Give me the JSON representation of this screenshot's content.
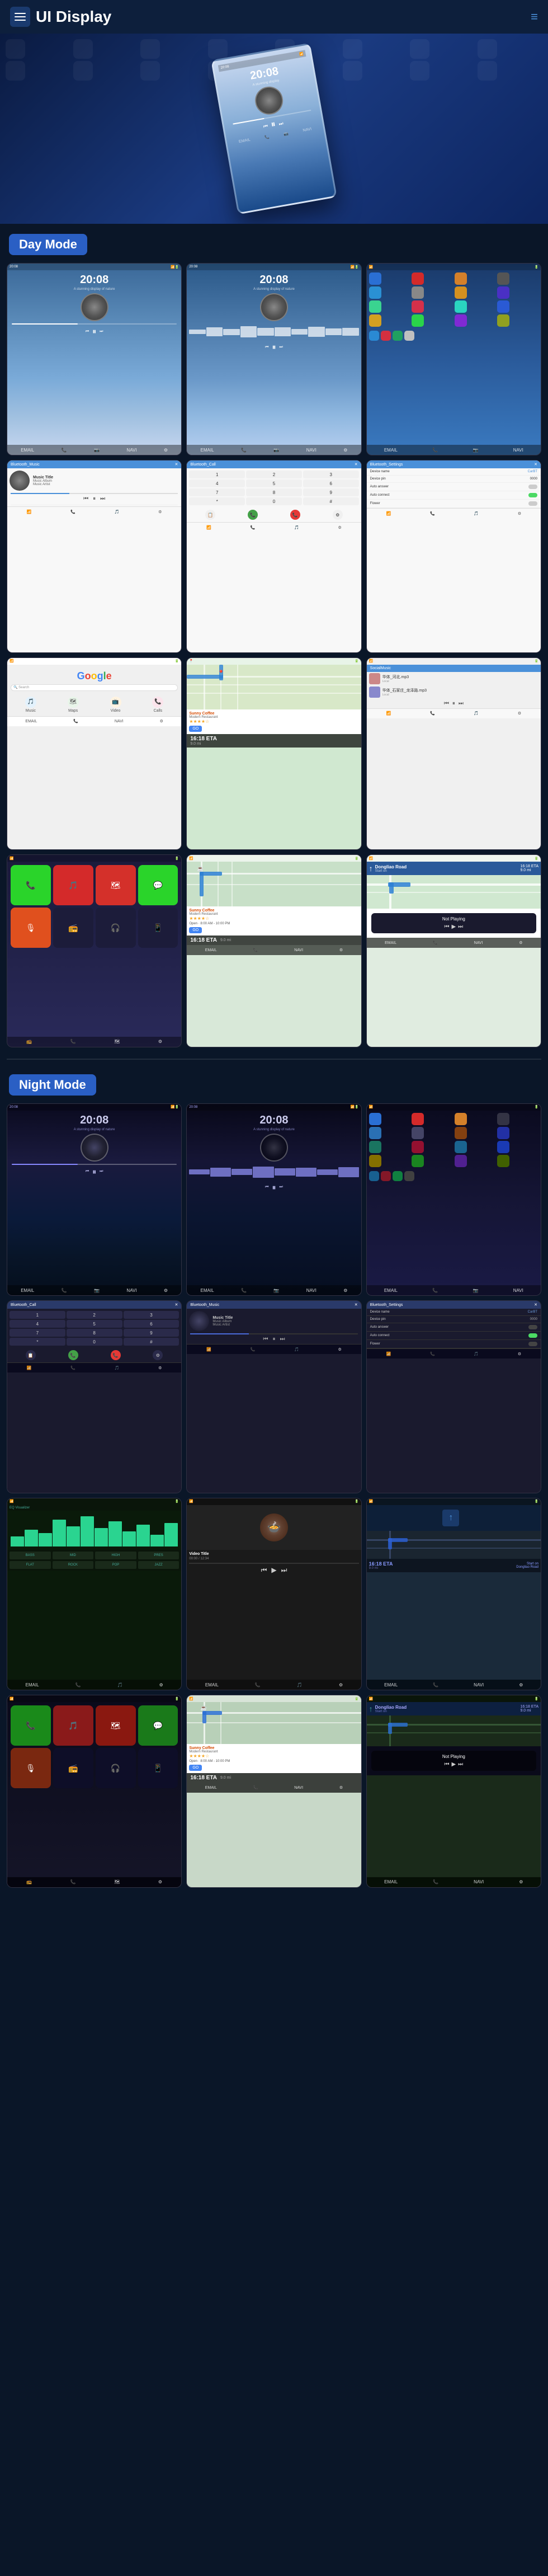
{
  "header": {
    "title": "UI Display",
    "menu_icon": "☰",
    "nav_icon": "≡"
  },
  "sections": {
    "day_mode": {
      "label": "Day Mode"
    },
    "night_mode": {
      "label": "Night Mode"
    }
  },
  "day_screens": [
    {
      "id": "day-music-1",
      "type": "music_player",
      "time": "20:08",
      "subtitle": "A stunning display of nature"
    },
    {
      "id": "day-music-2",
      "type": "music_player",
      "time": "20:08",
      "subtitle": "A stunning display of nature"
    },
    {
      "id": "day-apps",
      "type": "app_grid"
    },
    {
      "id": "day-bt-music",
      "type": "bluetooth_music",
      "title": "Bluetooth_Music",
      "track": "Music Title",
      "album": "Music Album",
      "artist": "Music Artist"
    },
    {
      "id": "day-bt-call",
      "type": "bluetooth_call",
      "title": "Bluetooth_Call"
    },
    {
      "id": "day-bt-settings",
      "type": "bluetooth_settings",
      "title": "Bluetooth_Settings",
      "device_name": "CarBT",
      "device_pin": "0000"
    },
    {
      "id": "day-google",
      "type": "google_search"
    },
    {
      "id": "day-navigation",
      "type": "navigation"
    },
    {
      "id": "day-social-music",
      "type": "social_music",
      "title": "SocialMusic"
    },
    {
      "id": "day-carplay",
      "type": "carplay"
    },
    {
      "id": "day-maps-coffee",
      "type": "maps_coffee",
      "place": "Sunny Coffee",
      "address": "Modern Restaurant",
      "rating": "★★★★☆"
    },
    {
      "id": "day-maps-eta",
      "type": "maps_eta",
      "eta_time": "16'10 ETA",
      "distance": "9.0 mi",
      "road": "Start on Dongliao Road"
    }
  ],
  "night_screens": [
    {
      "id": "night-music-1",
      "type": "music_player_night",
      "time": "20:08",
      "subtitle": "A stunning display of nature"
    },
    {
      "id": "night-music-2",
      "type": "music_player_night",
      "time": "20:08",
      "subtitle": "A stunning display of nature"
    },
    {
      "id": "night-apps",
      "type": "app_grid_night"
    },
    {
      "id": "night-bt-call",
      "type": "bluetooth_call_night",
      "title": "Bluetooth_Call"
    },
    {
      "id": "night-bt-music",
      "type": "bluetooth_music_night",
      "title": "Bluetooth_Music",
      "track": "Music Title",
      "album": "Music Album",
      "artist": "Music Artist"
    },
    {
      "id": "night-bt-settings",
      "type": "bluetooth_settings_night",
      "title": "Bluetooth_Settings",
      "device_name": "CarBT",
      "device_pin": "0000"
    },
    {
      "id": "night-equalizer",
      "type": "equalizer_night"
    },
    {
      "id": "night-video",
      "type": "video_night"
    },
    {
      "id": "night-navigation",
      "type": "navigation_night"
    },
    {
      "id": "night-carplay",
      "type": "carplay_night"
    },
    {
      "id": "night-maps-coffee",
      "type": "maps_coffee_night",
      "place": "Sunny Coffee",
      "address": "Modern Restaurant"
    },
    {
      "id": "night-maps-eta",
      "type": "maps_eta_night",
      "eta_time": "16'10 ETA",
      "distance": "9.0 mi",
      "road": "Start on Dongliao Road"
    }
  ],
  "labels": {
    "music_title": "Music Title",
    "music_album": "Music Album",
    "music_artist": "Music Artist",
    "bluetooth_music": "Bluetooth_Music",
    "bluetooth_call": "Bluetooth_Call",
    "bluetooth_settings": "Bluetooth_Settings",
    "social_music": "SocialMusic",
    "device_name_label": "Device name",
    "device_pin_label": "Device pin",
    "auto_answer_label": "Auto answer",
    "auto_connect_label": "Auto connect",
    "flower_label": "Flower",
    "car_bt": "CarBT",
    "pin_0000": "0000",
    "not_playing": "Not Playing",
    "night_mode": "Night Mode",
    "day_mode": "Day Mode",
    "go": "GO",
    "sunny_coffee": "Sunny Coffee",
    "modern_restaurant": "Modern Restaurant",
    "eta": "16:18 ETA",
    "distance": "9.0 mi",
    "start_on": "Start on",
    "dongliao_road": "Dongliao Road"
  }
}
